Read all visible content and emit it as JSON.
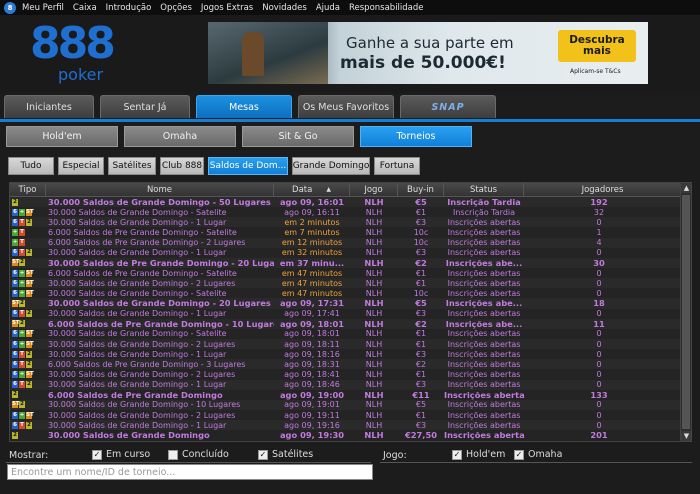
{
  "menu": {
    "logo": "8",
    "items": [
      "Meu Perfil",
      "Caixa",
      "Introdução",
      "Opções",
      "Jogos Extras",
      "Novidades",
      "Ajuda",
      "Responsabilidade"
    ]
  },
  "logo": {
    "top": "888",
    "bottom": "poker"
  },
  "banner": {
    "line1": "Ganhe a sua parte em",
    "line2": "mais de 50.000€!",
    "cta": "Descubra mais",
    "note": "Aplicam-se T&Cs"
  },
  "main_tabs": [
    {
      "label": "Iniciantes",
      "active": false
    },
    {
      "label": "Sentar Já",
      "active": false
    },
    {
      "label": "Mesas",
      "active": true
    },
    {
      "label": "Os Meus Favoritos",
      "active": false
    },
    {
      "label": "SNAP",
      "active": false
    }
  ],
  "sub_tabs": [
    {
      "label": "Hold'em",
      "active": false
    },
    {
      "label": "Omaha",
      "active": false
    },
    {
      "label": "Sit & Go",
      "active": false
    },
    {
      "label": "Torneios",
      "active": true
    }
  ],
  "filters": [
    {
      "label": "Tudo",
      "active": false
    },
    {
      "label": "Especial",
      "active": false
    },
    {
      "label": "Satélites",
      "active": false
    },
    {
      "label": "Club 888",
      "active": false
    },
    {
      "label": "Saldos de Dom...",
      "active": true
    },
    {
      "label": "Grande Domingo",
      "active": false
    },
    {
      "label": "Fortuna",
      "active": false
    }
  ],
  "table": {
    "headers": {
      "tipo": "Tipo",
      "nome": "Nome",
      "data": "Data",
      "sort_icon": "▲",
      "jogo": "Jogo",
      "buyin": "Buy-in",
      "status": "Status",
      "jogadores": "Jogadores"
    },
    "rows": [
      {
        "icons": [
          "y"
        ],
        "nome": "30.000 Saldos de Grande Domingo - 50 Lugares",
        "data": "ago 09, 16:01",
        "jogo": "NLH",
        "buyin": "€5",
        "status": "Inscrição Tardia",
        "jogadores": "192",
        "bold": true,
        "orange": false
      },
      {
        "icons": [
          "b",
          "g",
          "o"
        ],
        "nome": "30.000 Saldos de Grande Domingo - Satelite",
        "data": "ago 09, 16:11",
        "jogo": "NLH",
        "buyin": "€1",
        "status": "Inscrição Tardia",
        "jogadores": "32",
        "bold": false,
        "orange": false
      },
      {
        "icons": [
          "b",
          "r",
          "y"
        ],
        "nome": "30.000 Saldos de Grande Domingo - 1 Lugar",
        "data": "em 2 minutos",
        "jogo": "NLH",
        "buyin": "€3",
        "status": "Inscrições abertas",
        "jogadores": "0",
        "bold": false,
        "orange": true
      },
      {
        "icons": [
          "g",
          "r"
        ],
        "nome": "6.000 Saldos de Pre Grande Domingo - Satelite",
        "data": "em 7 minutos",
        "jogo": "NLH",
        "buyin": "10c",
        "status": "Inscrições abertas",
        "jogadores": "1",
        "bold": false,
        "orange": true
      },
      {
        "icons": [
          "g",
          "r"
        ],
        "nome": "6.000 Saldos de Pre Grande Domingo - 2 Lugares",
        "data": "em 12 minutos",
        "jogo": "NLH",
        "buyin": "10c",
        "status": "Inscrições abertas",
        "jogadores": "4",
        "bold": false,
        "orange": true
      },
      {
        "icons": [
          "b",
          "r",
          "y"
        ],
        "nome": "30.000 Saldos de Grande Domingo - 1 Lugar",
        "data": "em 32 minutos",
        "jogo": "NLH",
        "buyin": "€3",
        "status": "Inscrições abertas",
        "jogadores": "0",
        "bold": false,
        "orange": true
      },
      {
        "icons": [
          "o",
          "y"
        ],
        "nome": "30.000 Saldos de Pre Grande Domingo - 20 Lugares",
        "data": "em 37 minu...",
        "jogo": "NLH",
        "buyin": "€2",
        "status": "Inscrições abe...",
        "jogadores": "30",
        "bold": true,
        "orange": true
      },
      {
        "icons": [
          "b",
          "g",
          "o"
        ],
        "nome": "6.000 Saldos de Pre Grande Domingo - Satelite",
        "data": "em 47 minutos",
        "jogo": "NLH",
        "buyin": "€1",
        "status": "Inscrições abertas",
        "jogadores": "0",
        "bold": false,
        "orange": true
      },
      {
        "icons": [
          "b",
          "g",
          "o"
        ],
        "nome": "30.000 Saldos de Grande Domingo - 2 Lugares",
        "data": "em 47 minutos",
        "jogo": "NLH",
        "buyin": "€1",
        "status": "Inscrições abertas",
        "jogadores": "0",
        "bold": false,
        "orange": true
      },
      {
        "icons": [
          "b",
          "g",
          "o"
        ],
        "nome": "30.000 Saldos de Grande Domingo - Satelite",
        "data": "em 47 minutos",
        "jogo": "NLH",
        "buyin": "10c",
        "status": "Inscrições abertas",
        "jogadores": "0",
        "bold": false,
        "orange": true
      },
      {
        "icons": [
          "o",
          "y"
        ],
        "nome": "30.000 Saldos de Grande Domingo - 20 Lugares",
        "data": "ago 09, 17:31",
        "jogo": "NLH",
        "buyin": "€5",
        "status": "Inscrições abe...",
        "jogadores": "18",
        "bold": true,
        "orange": false
      },
      {
        "icons": [
          "b",
          "r",
          "y"
        ],
        "nome": "30.000 Saldos de Grande Domingo - 1 Lugar",
        "data": "ago 09, 17:41",
        "jogo": "NLH",
        "buyin": "€3",
        "status": "Inscrições abertas",
        "jogadores": "0",
        "bold": false,
        "orange": false
      },
      {
        "icons": [
          "o",
          "y"
        ],
        "nome": "6.000 Saldos de Pre Grande Domingo - 10 Lugares",
        "data": "ago 09, 18:01",
        "jogo": "NLH",
        "buyin": "€2",
        "status": "Inscrições abe...",
        "jogadores": "11",
        "bold": true,
        "orange": false
      },
      {
        "icons": [
          "b",
          "g",
          "o"
        ],
        "nome": "30.000 Saldos de Grande Domingo - Satelite",
        "data": "ago 09, 18:01",
        "jogo": "NLH",
        "buyin": "€1",
        "status": "Inscrições abertas",
        "jogadores": "0",
        "bold": false,
        "orange": false
      },
      {
        "icons": [
          "b",
          "g",
          "o"
        ],
        "nome": "30.000 Saldos de Grande Domingo - 2 Lugares",
        "data": "ago 09, 18:11",
        "jogo": "NLH",
        "buyin": "€1",
        "status": "Inscrições abertas",
        "jogadores": "0",
        "bold": false,
        "orange": false
      },
      {
        "icons": [
          "b",
          "r",
          "y"
        ],
        "nome": "30.000 Saldos de Grande Domingo - 1 Lugar",
        "data": "ago 09, 18:16",
        "jogo": "NLH",
        "buyin": "€3",
        "status": "Inscrições abertas",
        "jogadores": "0",
        "bold": false,
        "orange": false
      },
      {
        "icons": [
          "b",
          "r",
          "y"
        ],
        "nome": "6.000 Saldos de Pre Grande Domingo - 3 Lugares",
        "data": "ago 09, 18:31",
        "jogo": "NLH",
        "buyin": "€2",
        "status": "Inscrições abertas",
        "jogadores": "0",
        "bold": false,
        "orange": false
      },
      {
        "icons": [
          "b",
          "g",
          "o"
        ],
        "nome": "30.000 Saldos de Grande Domingo - 2 Lugares",
        "data": "ago 09, 18:41",
        "jogo": "NLH",
        "buyin": "€1",
        "status": "Inscrições abertas",
        "jogadores": "0",
        "bold": false,
        "orange": false
      },
      {
        "icons": [
          "b",
          "r",
          "y"
        ],
        "nome": "30.000 Saldos de Grande Domingo - 1 Lugar",
        "data": "ago 09, 18:46",
        "jogo": "NLH",
        "buyin": "€3",
        "status": "Inscrições abertas",
        "jogadores": "0",
        "bold": false,
        "orange": false
      },
      {
        "icons": [
          "y"
        ],
        "nome": "6.000 Saldos de Pre Grande Domingo",
        "data": "ago 09, 19:00",
        "jogo": "NLH",
        "buyin": "€11",
        "status": "Inscrições abertas",
        "jogadores": "133",
        "bold": true,
        "orange": false
      },
      {
        "icons": [
          "o",
          "y"
        ],
        "nome": "30.000 Saldos de Grande Domingo - 10 Lugares",
        "data": "ago 09, 19:01",
        "jogo": "NLH",
        "buyin": "€5",
        "status": "Inscrições abertas",
        "jogadores": "0",
        "bold": false,
        "orange": false
      },
      {
        "icons": [
          "b",
          "g",
          "o"
        ],
        "nome": "30.000 Saldos de Grande Domingo - 2 Lugares",
        "data": "ago 09, 19:11",
        "jogo": "NLH",
        "buyin": "€1",
        "status": "Inscrições abertas",
        "jogadores": "0",
        "bold": false,
        "orange": false
      },
      {
        "icons": [
          "b",
          "r",
          "y"
        ],
        "nome": "30.000 Saldos de Grande Domingo - 1 Lugar",
        "data": "ago 09, 19:16",
        "jogo": "NLH",
        "buyin": "€3",
        "status": "Inscrições abertas",
        "jogadores": "0",
        "bold": false,
        "orange": false
      },
      {
        "icons": [
          "y"
        ],
        "nome": "30.000 Saldos de Grande Domingo",
        "data": "ago 09, 19:30",
        "jogo": "NLH",
        "buyin": "€27,50",
        "status": "Inscrições abertas",
        "jogadores": "201",
        "bold": true,
        "orange": false
      }
    ]
  },
  "bottom": {
    "show_label": "Mostrar:",
    "show_options": [
      {
        "label": "Em curso",
        "checked": true
      },
      {
        "label": "Concluído",
        "checked": false
      },
      {
        "label": "Satélites",
        "checked": true
      }
    ],
    "game_label": "Jogo:",
    "game_options": [
      {
        "label": "Hold'em",
        "checked": true
      },
      {
        "label": "Omaha",
        "checked": true
      }
    ],
    "search_placeholder": "Encontre um nome/ID de torneio..."
  },
  "colors": {
    "accent": "#1580d3",
    "name_purple": "#c27ae0",
    "time_orange": "#f0a23a"
  }
}
